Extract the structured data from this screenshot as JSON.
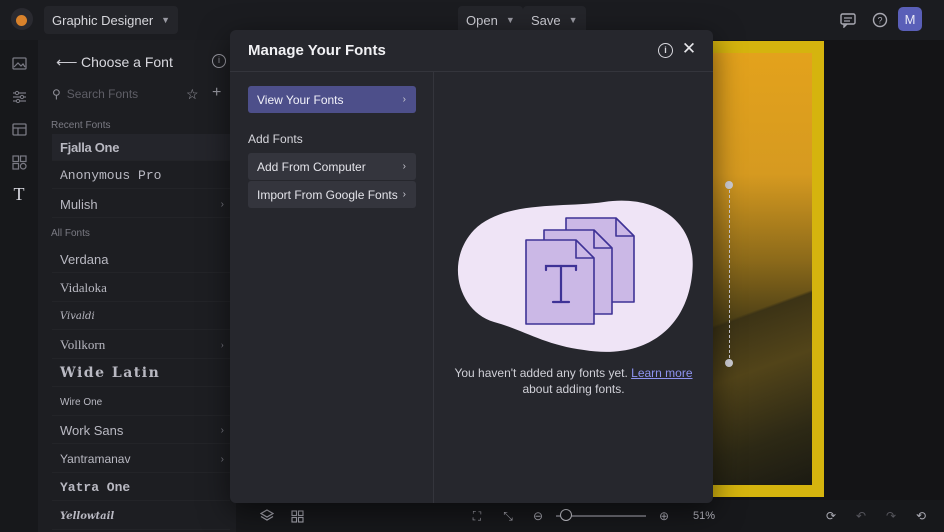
{
  "topbar": {
    "project_title": "Graphic Designer",
    "open_label": "Open",
    "save_label": "Save",
    "avatar_initial": "M"
  },
  "font_panel": {
    "title": "Choose a Font",
    "search_placeholder": "Search Fonts",
    "recent_label": "Recent Fonts",
    "all_label": "All Fonts",
    "recent_fonts": [
      "Fjalla One",
      "Anonymous Pro",
      "Mulish"
    ],
    "all_fonts": [
      "Verdana",
      "Vidaloka",
      "Vivaldi",
      "Vollkorn",
      "Wide Latin",
      "Wire One",
      "Work Sans",
      "Yantramanav",
      "Yatra One",
      "Yellowtail"
    ]
  },
  "modal": {
    "title": "Manage Your Fonts",
    "view_fonts_label": "View Your Fonts",
    "add_fonts_heading": "Add Fonts",
    "add_from_computer_label": "Add From Computer",
    "import_google_label": "Import From Google Fonts",
    "empty_text_1": "You haven't added any fonts yet.",
    "learn_more_label": "Learn more",
    "empty_text_2": "about adding fonts."
  },
  "bottombar": {
    "zoom_level": "51%"
  },
  "colors": {
    "accent": "#4d4f8a",
    "link": "#8e93f0",
    "illustration_blob": "#efe4f6",
    "illustration_page": "#cbb8e6",
    "illustration_stroke": "#3e3296"
  }
}
